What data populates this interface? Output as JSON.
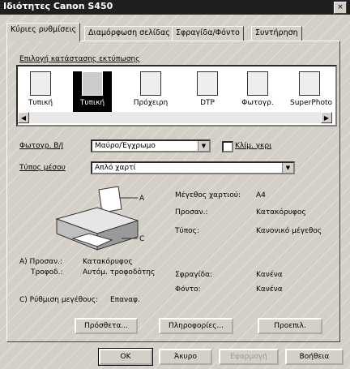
{
  "window": {
    "title": "Ιδιότητες Canon S450",
    "close": "×"
  },
  "tabs": [
    {
      "label": "Κύριες ρυθμίσεις",
      "active": true
    },
    {
      "label": "Διαμόρφωση σελίδας"
    },
    {
      "label": "Σφραγίδα/Φόντο"
    },
    {
      "label": "Συντήρηση"
    }
  ],
  "print_mode_label": "Επιλογή κατάστασης εκτύπωσης",
  "media_list": [
    {
      "label": "Τυπική",
      "icon": "document-icon"
    },
    {
      "label": "Τυπική",
      "icon": "document-icon",
      "selected": true
    },
    {
      "label": "Πρόχειρη",
      "icon": "draft-icon"
    },
    {
      "label": "DTP",
      "icon": "dtp-icon"
    },
    {
      "label": "Φωτογρ.",
      "icon": "photo-icon"
    },
    {
      "label": "SuperPhoto",
      "icon": "superphoto-icon"
    }
  ],
  "color_label": "Φωτογρ. B/J",
  "color_value": "Μαύρο/Έγχρωμο",
  "grayscale_label": "Κλίμ. γκρι",
  "media_type_label": "Τύπος μέσου",
  "media_type_value": "Απλό χαρτί",
  "callouts": {
    "a": "A",
    "c": "C"
  },
  "info": [
    {
      "k": "Μέγεθος χαρτιού:",
      "v": "A4"
    },
    {
      "k": "Προσαν.:",
      "v": "Κατακόρυφος"
    },
    {
      "k": "Τύπος:",
      "v": "Κανονικό μέγεθος"
    }
  ],
  "a_orient_label": "A) Προσαν.:",
  "a_orient_value": "Κατακόρυφος",
  "a_feed_label": "Τροφοδ.:",
  "a_feed_value": "Αυτόμ. τροφοδότης",
  "stamp_label": "Σφραγίδα:",
  "stamp_value": "Κανένα",
  "background_label": "Φόντο:",
  "background_value": "Κανένα",
  "c_label": "C) Ρύθμιση μεγέθους:",
  "c_value": "Επαναφ.",
  "buttons": {
    "extra": "Πρόσθετα...",
    "info": "Πληροφορίες...",
    "default": "Προεπιλ.",
    "ok": "OK",
    "cancel": "Άκυρο",
    "apply": "Εφαρμογή",
    "help": "Βοήθεια"
  }
}
